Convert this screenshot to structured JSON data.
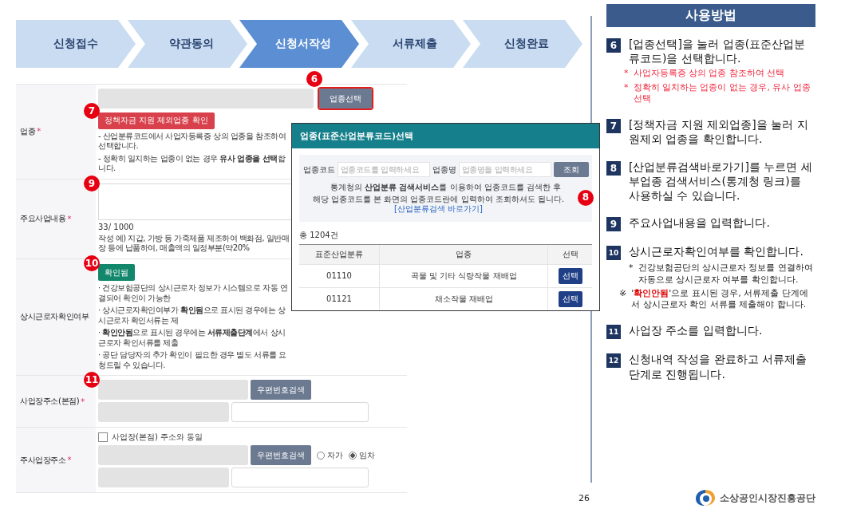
{
  "steps": [
    {
      "label": "신청접수",
      "selected": false
    },
    {
      "label": "약관동의",
      "selected": false
    },
    {
      "label": "신청서작성",
      "selected": true
    },
    {
      "label": "서류제출",
      "selected": false
    },
    {
      "label": "신청완료",
      "selected": false
    }
  ],
  "form": {
    "rows": [
      {
        "kind": "industry",
        "label": "업종",
        "required": true,
        "select_button": {
          "label": "업종선택",
          "callout": "6"
        },
        "exclude_button": {
          "label": "정책자금 지원 제외업종 확인",
          "callout": "7"
        },
        "notes": [
          "- 산업분류코드에서 사업자등록증 상의 업종을 참조하여 선택합니다.",
          "- 정확히 일치하는 업종이 없는 경우 **유사 업종을 선택**합니다."
        ]
      },
      {
        "kind": "textarea",
        "label": "주요사업내용",
        "required": true,
        "callout": "9",
        "counter": "33/ 1000",
        "example": "작성 예) 지갑, 가방 등 가죽제품 제조하여 백화점, 일반매장 등에 납품하여, 매출액의 일정부분(약20%"
      },
      {
        "kind": "status",
        "label": "상시근로자확인여부",
        "required": false,
        "callout": "10",
        "status_button": "확인됨",
        "notes": [
          "· 건강보험공단의 상시근로자 정보가 시스템으로 자동 연결되어 확인이 가능한",
          "· 상시근로자확인여부가 **확인됨**으로 표시된 경우에는 상시근로자 확인서류는 제",
          "· **확인안됨**으로 표시된 경우에는 **서류제출단계**에서 상시근로자 확인서류를 제출",
          "· 공단 담당자의 추가 확인이 필요한 경우 별도 서류를 요청드릴 수 있습니다."
        ]
      },
      {
        "kind": "address",
        "label": "사업장주소(본점)",
        "required": true,
        "callout": "11",
        "search_button": "우편번호검색"
      },
      {
        "kind": "address",
        "label": "주사업장주소",
        "required": true,
        "same_as": {
          "label": "사업장(본점) 주소와 동일",
          "checked": false
        },
        "search_button": "우편번호검색",
        "ownership": [
          {
            "label": "자가",
            "selected": false
          },
          {
            "label": "임차",
            "selected": true
          }
        ]
      }
    ]
  },
  "popup": {
    "title": "업종(표준산업분류코드)선택",
    "fields": [
      {
        "label": "업종코드",
        "placeholder": "업종코드를 입력하세요"
      },
      {
        "label": "업종명",
        "placeholder": "업종명을 입력하세요"
      }
    ],
    "search_button": "조회",
    "info": [
      "통계청의 **산업분류 검색서비스**를 이용하여 업종코드를 검색한 후",
      "해당 업종코드를 본 화면의 업종코드란에 입력하여 조회하셔도 됩니다."
    ],
    "link": "[산업분류검색 바로가기]",
    "callout": "8",
    "total": "총 1204건",
    "columns": [
      "표준산업분류",
      "업종",
      "선택"
    ],
    "rows": [
      {
        "code": "01110",
        "name": "곡물 및 기타 식량작물 재배업",
        "action": "선택"
      },
      {
        "code": "01121",
        "name": "채소작물 재배업",
        "action": "선택"
      }
    ]
  },
  "guide": {
    "title": "사용방법",
    "steps": [
      {
        "number": "6",
        "text": "[업종선택]을 눌러 업종(표준산업분류코드)을 선택합니다.",
        "notes": [
          {
            "kind": "alert",
            "mark": "*",
            "text": "사업자등록증 상의 업종 참조하여 선택"
          },
          {
            "kind": "alert",
            "mark": "*",
            "text": "정확히 일치하는 업종이 없는 경우, 유사 업종 선택"
          }
        ]
      },
      {
        "number": "7",
        "text": "[정책자금 지원 제외업종]을 눌러 지원제외 업종을 확인합니다."
      },
      {
        "number": "8",
        "text": "[산업분류검색바로가기]를 누르면 세부업종 검색서비스(통계청 링크)를 사용하실 수 있습니다."
      },
      {
        "number": "9",
        "text": "주요사업내용을 입력합니다."
      },
      {
        "number": "10",
        "text": "상시근로자확인여부를 확인합니다.",
        "notes": [
          {
            "kind": "plain",
            "mark": "*",
            "text": "건강보험공단의 상시근로자 정보를 연결하여 자동으로 상시근로자 여부를 확인합니다."
          },
          {
            "kind": "warning",
            "mark": "※",
            "text": "'**확인안됨**'으로 표시된 경우,  서류제출 단계에서 상시근로자 확인 서류를 제출해야 합니다."
          }
        ]
      },
      {
        "number": "11",
        "text": "사업장 주소를 입력합니다."
      },
      {
        "number": "12",
        "text": "신청내역 작성을 완료하고 서류제출단계로 진행됩니다."
      }
    ]
  },
  "footer": {
    "page_number": "26",
    "org_name": "소상공인시장진흥공단"
  }
}
